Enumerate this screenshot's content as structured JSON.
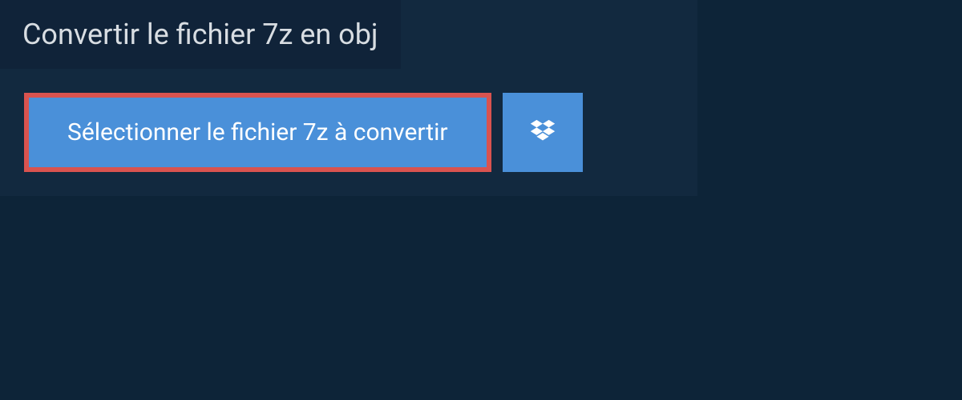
{
  "header": {
    "title": "Convertir le fichier 7z en obj"
  },
  "actions": {
    "select_file_label": "Sélectionner le fichier 7z à convertir"
  },
  "colors": {
    "page_bg": "#0d2438",
    "panel_bg": "#12293f",
    "title_bg": "#102339",
    "button_bg": "#4a90d9",
    "highlight_border": "#d9534f",
    "text_light": "#d8dde2",
    "text_white": "#ffffff"
  }
}
